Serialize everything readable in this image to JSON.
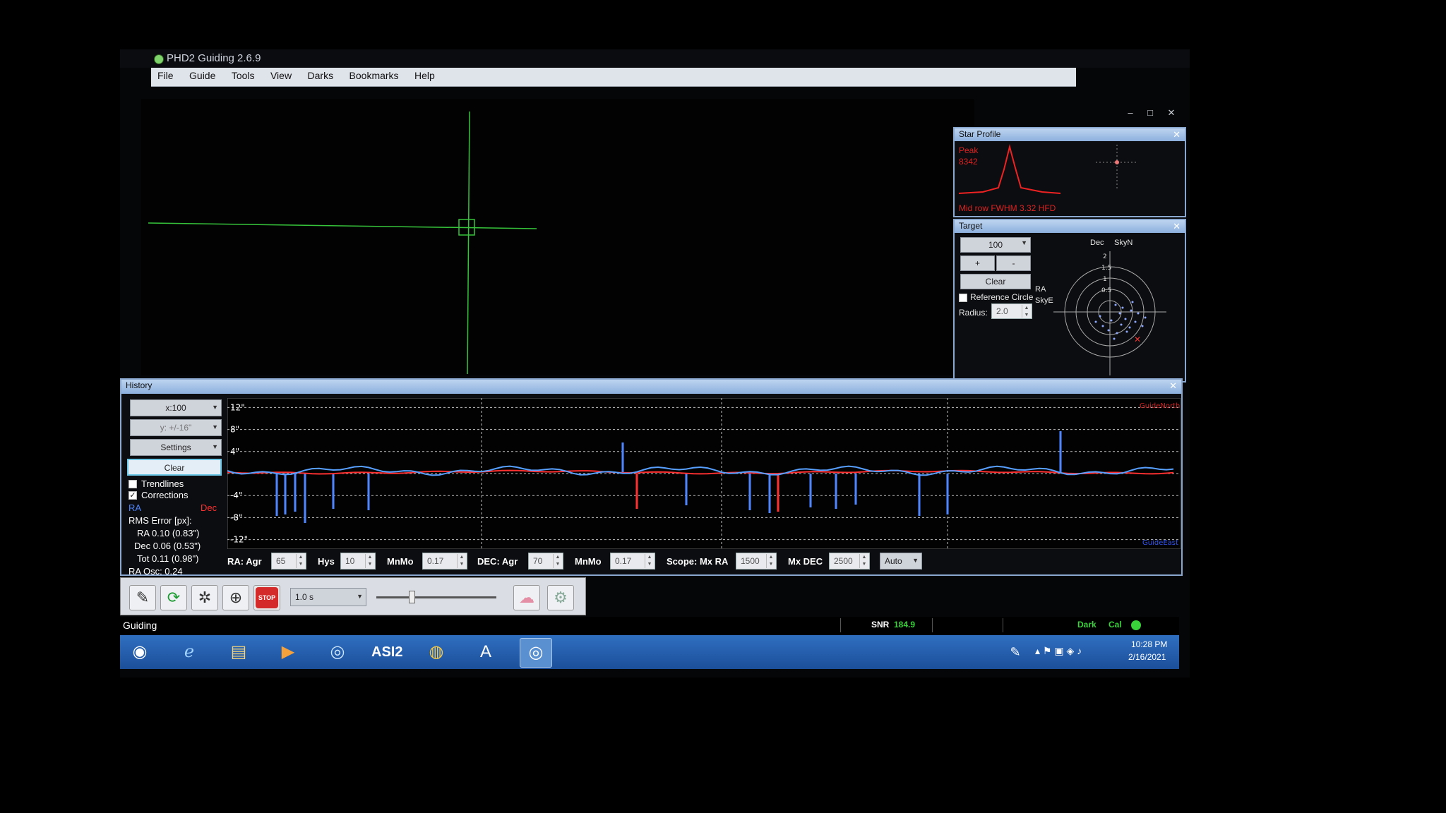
{
  "window": {
    "title": "PHD2 Guiding 2.6.9"
  },
  "menu": [
    "File",
    "Guide",
    "Tools",
    "View",
    "Darks",
    "Bookmarks",
    "Help"
  ],
  "window_controls": {
    "minimize": "–",
    "maximize": "□",
    "close": "✕"
  },
  "star_profile": {
    "title": "Star Profile",
    "peak_label": "Peak",
    "peak_value": "8342",
    "footer": "Mid row FWHM 3.32  HFD"
  },
  "target": {
    "title": "Target",
    "zoom": "100",
    "plus": "+",
    "minus": "-",
    "clear": "Clear",
    "reference_circle": "Reference Circle",
    "radius_label": "Radius:",
    "radius_value": "2.0",
    "axis_dec": "Dec",
    "axis_skyn": "SkyN",
    "axis_ra": "RA",
    "axis_skye": "SkyE",
    "ring_labels": [
      "2",
      "1.5",
      "1",
      "0.5"
    ]
  },
  "history": {
    "title": "History",
    "x_scale": "x:100",
    "y_scale": "y: +/-16\"",
    "settings": "Settings",
    "clear": "Clear",
    "trendlines": "Trendlines",
    "corrections": "Corrections",
    "legend_ra": "RA",
    "legend_dec": "Dec",
    "rms_title": "RMS Error [px]:",
    "rms_ra": "RA 0.10 (0.83\")",
    "rms_dec": "Dec 0.06 (0.53\")",
    "rms_tot": "Tot 0.11 (0.98\")",
    "ra_osc": "RA Osc: 0.24",
    "y_ticks": [
      "12\"",
      "8\"",
      "4\"",
      "-4\"",
      "-8\"",
      "-12\""
    ],
    "guide_north": "GuideNorth",
    "guide_east": "GuideEast"
  },
  "params": {
    "ra_agr_label": "RA: Agr",
    "ra_agr": "65",
    "hys_label": "Hys",
    "hys": "10",
    "mnmo1_label": "MnMo",
    "mnmo1": "0.17",
    "dec_agr_label": "DEC: Agr",
    "dec_agr": "70",
    "mnmo2_label": "MnMo",
    "mnmo2": "0.17",
    "mxra_label": "Scope: Mx RA",
    "mxra": "1500",
    "mxdec_label": "Mx DEC",
    "mxdec": "2500",
    "mode": "Auto"
  },
  "toolbar": {
    "exposure": "1.0 s",
    "stop": "STOP"
  },
  "status": {
    "state": "Guiding",
    "snr_label": "SNR",
    "snr_value": "184.9",
    "dark": "Dark",
    "cal": "Cal"
  },
  "taskbar": {
    "time": "10:28 PM",
    "date": "2/16/2021",
    "asi_label": "ASI2"
  },
  "colors": {
    "ra": "#4f86ff",
    "dec": "#ff3030",
    "grid": "#bfbfbf",
    "accent_green": "#39d23a"
  }
}
